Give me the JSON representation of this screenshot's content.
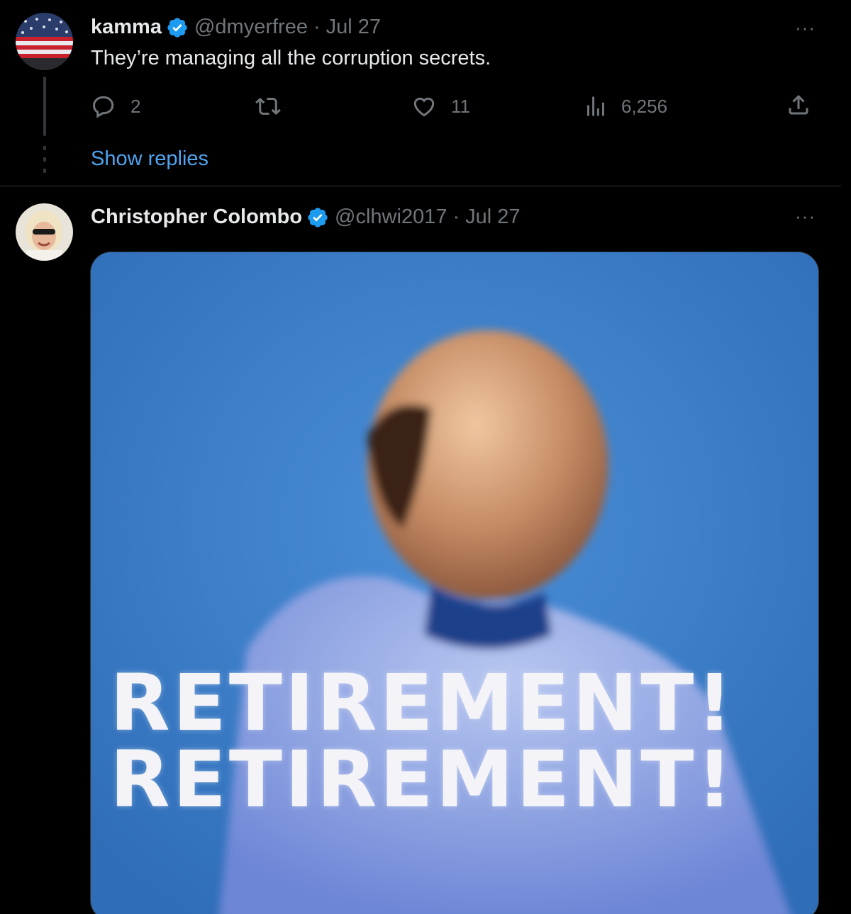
{
  "tweets": [
    {
      "author": {
        "name": "kamma",
        "handle": "@dmyerfree",
        "date": "Jul 27"
      },
      "text": "They’re managing all the corruption secrets.",
      "stats": {
        "replies": "2",
        "retweets": "",
        "likes": "11",
        "views": "6,256"
      },
      "show_replies": "Show replies"
    },
    {
      "author": {
        "name": "Christopher Colombo",
        "handle": "@clhwi2017",
        "date": "Jul 27"
      },
      "media": {
        "caption_line1": "RETIREMENT!",
        "caption_line2": "RETIREMENT!"
      }
    }
  ],
  "ui": {
    "separator": "·",
    "more": "···"
  },
  "icons": {
    "reply": "reply-icon",
    "retweet": "retweet-icon",
    "like": "heart-icon",
    "views": "views-icon",
    "share": "share-icon",
    "verified": "verified-badge-icon"
  },
  "colors": {
    "background": "#000000",
    "text": "#e7e9ea",
    "muted": "#71767b",
    "link": "#4fa4ef",
    "verified": "#1d9bf0"
  }
}
